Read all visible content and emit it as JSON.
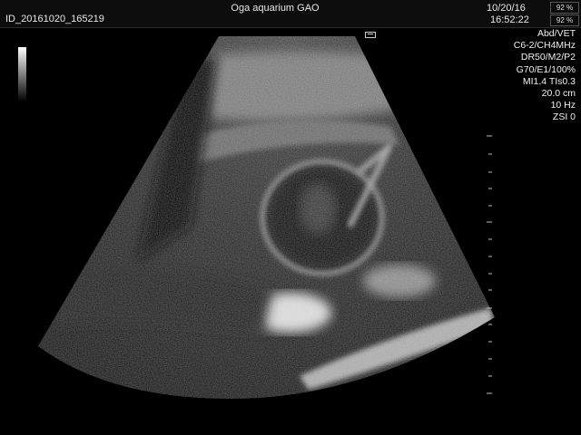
{
  "header": {
    "patient_id": "ID_20161020_165219",
    "title": "Oga aquarium GAO",
    "date": "10/20/16",
    "time": "16:52:22",
    "indicator_1": "92 %",
    "indicator_2": "92 %"
  },
  "parameters": [
    "Abd/VET",
    "C6-2/CH4MHz",
    "DR50/M2/P2",
    "G70/E1/100%",
    "MI1.4  TIs0.3",
    "20.0 cm",
    "10 Hz",
    "ZSI 0"
  ],
  "icons": {
    "grayscale_bar": "grayscale-bar-icon",
    "probe_orientation": "probe-orientation-icon"
  }
}
